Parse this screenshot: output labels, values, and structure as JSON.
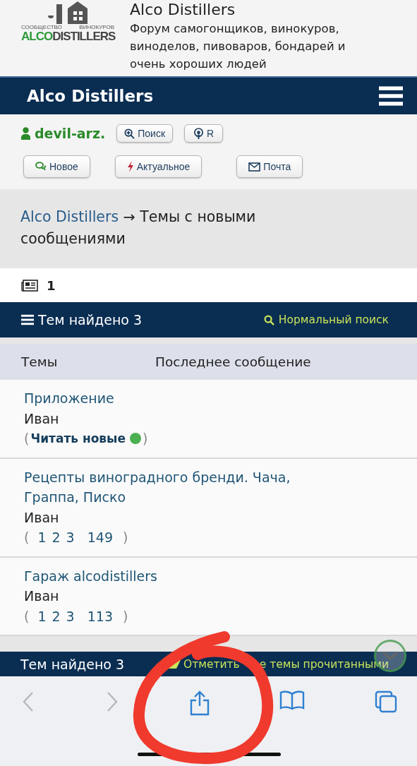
{
  "site_header": {
    "title": "Alco Distillers",
    "tagline": "Форум самогонщиков, винокуров, виноделов, пивоваров, бондарей и очень хороших людей"
  },
  "logo": {
    "top_left": "СООБЩЕСТВО",
    "top_right": "ВИНОКУРОВ",
    "name_green": "ALCO",
    "name_dark": "DISTILLERS"
  },
  "navbar": {
    "title": "Alco Distillers"
  },
  "user": {
    "name": "devil-arz."
  },
  "user_buttons": [
    {
      "kind": "search",
      "label": "Поиск"
    },
    {
      "kind": "rss",
      "label": "R"
    }
  ],
  "quick_links": [
    {
      "kind": "new",
      "label": "Новое"
    },
    {
      "kind": "hot",
      "label": "Актуальное"
    },
    {
      "kind": "mail",
      "label": "Почта"
    }
  ],
  "breadcrumb": {
    "link": "Alco Distillers",
    "separator": "→",
    "current": "Темы с новыми сообщениями"
  },
  "pagination": {
    "page": "1"
  },
  "results_bar": {
    "count": "Тем найдено 3",
    "search_link": "Нормальный поиск"
  },
  "table": {
    "columns": [
      "Темы",
      "Последнее сообщение"
    ],
    "rows": [
      {
        "title": "Приложение",
        "author": "Иван",
        "kind": "new",
        "new_link": {
          "open": "(",
          "label": "Читать новые",
          "color": "#4caf50",
          "close": ")"
        }
      },
      {
        "title": "Рецепты виноградного бренди. Чача, Граппа, Писко",
        "author": "Иван",
        "kind": "pages",
        "page_links": {
          "open": "(",
          "links": [
            "1",
            "2",
            "3",
            "149"
          ],
          "close": ")"
        }
      },
      {
        "title": "Гараж alcodistillers",
        "author": "Иван",
        "kind": "pages",
        "page_links": {
          "open": "(",
          "links": [
            "1",
            "2",
            "3",
            "113"
          ],
          "close": ")"
        }
      }
    ]
  },
  "footer_bar": {
    "count": "Тем найдено 3",
    "mark_read_start": "Отметить",
    "mark_read_end": "е темы прочитанными"
  },
  "browser_toolbar": {
    "back": {
      "disabled": true
    },
    "forward": {
      "disabled": true
    }
  },
  "annotation": {
    "kind": "circle"
  }
}
